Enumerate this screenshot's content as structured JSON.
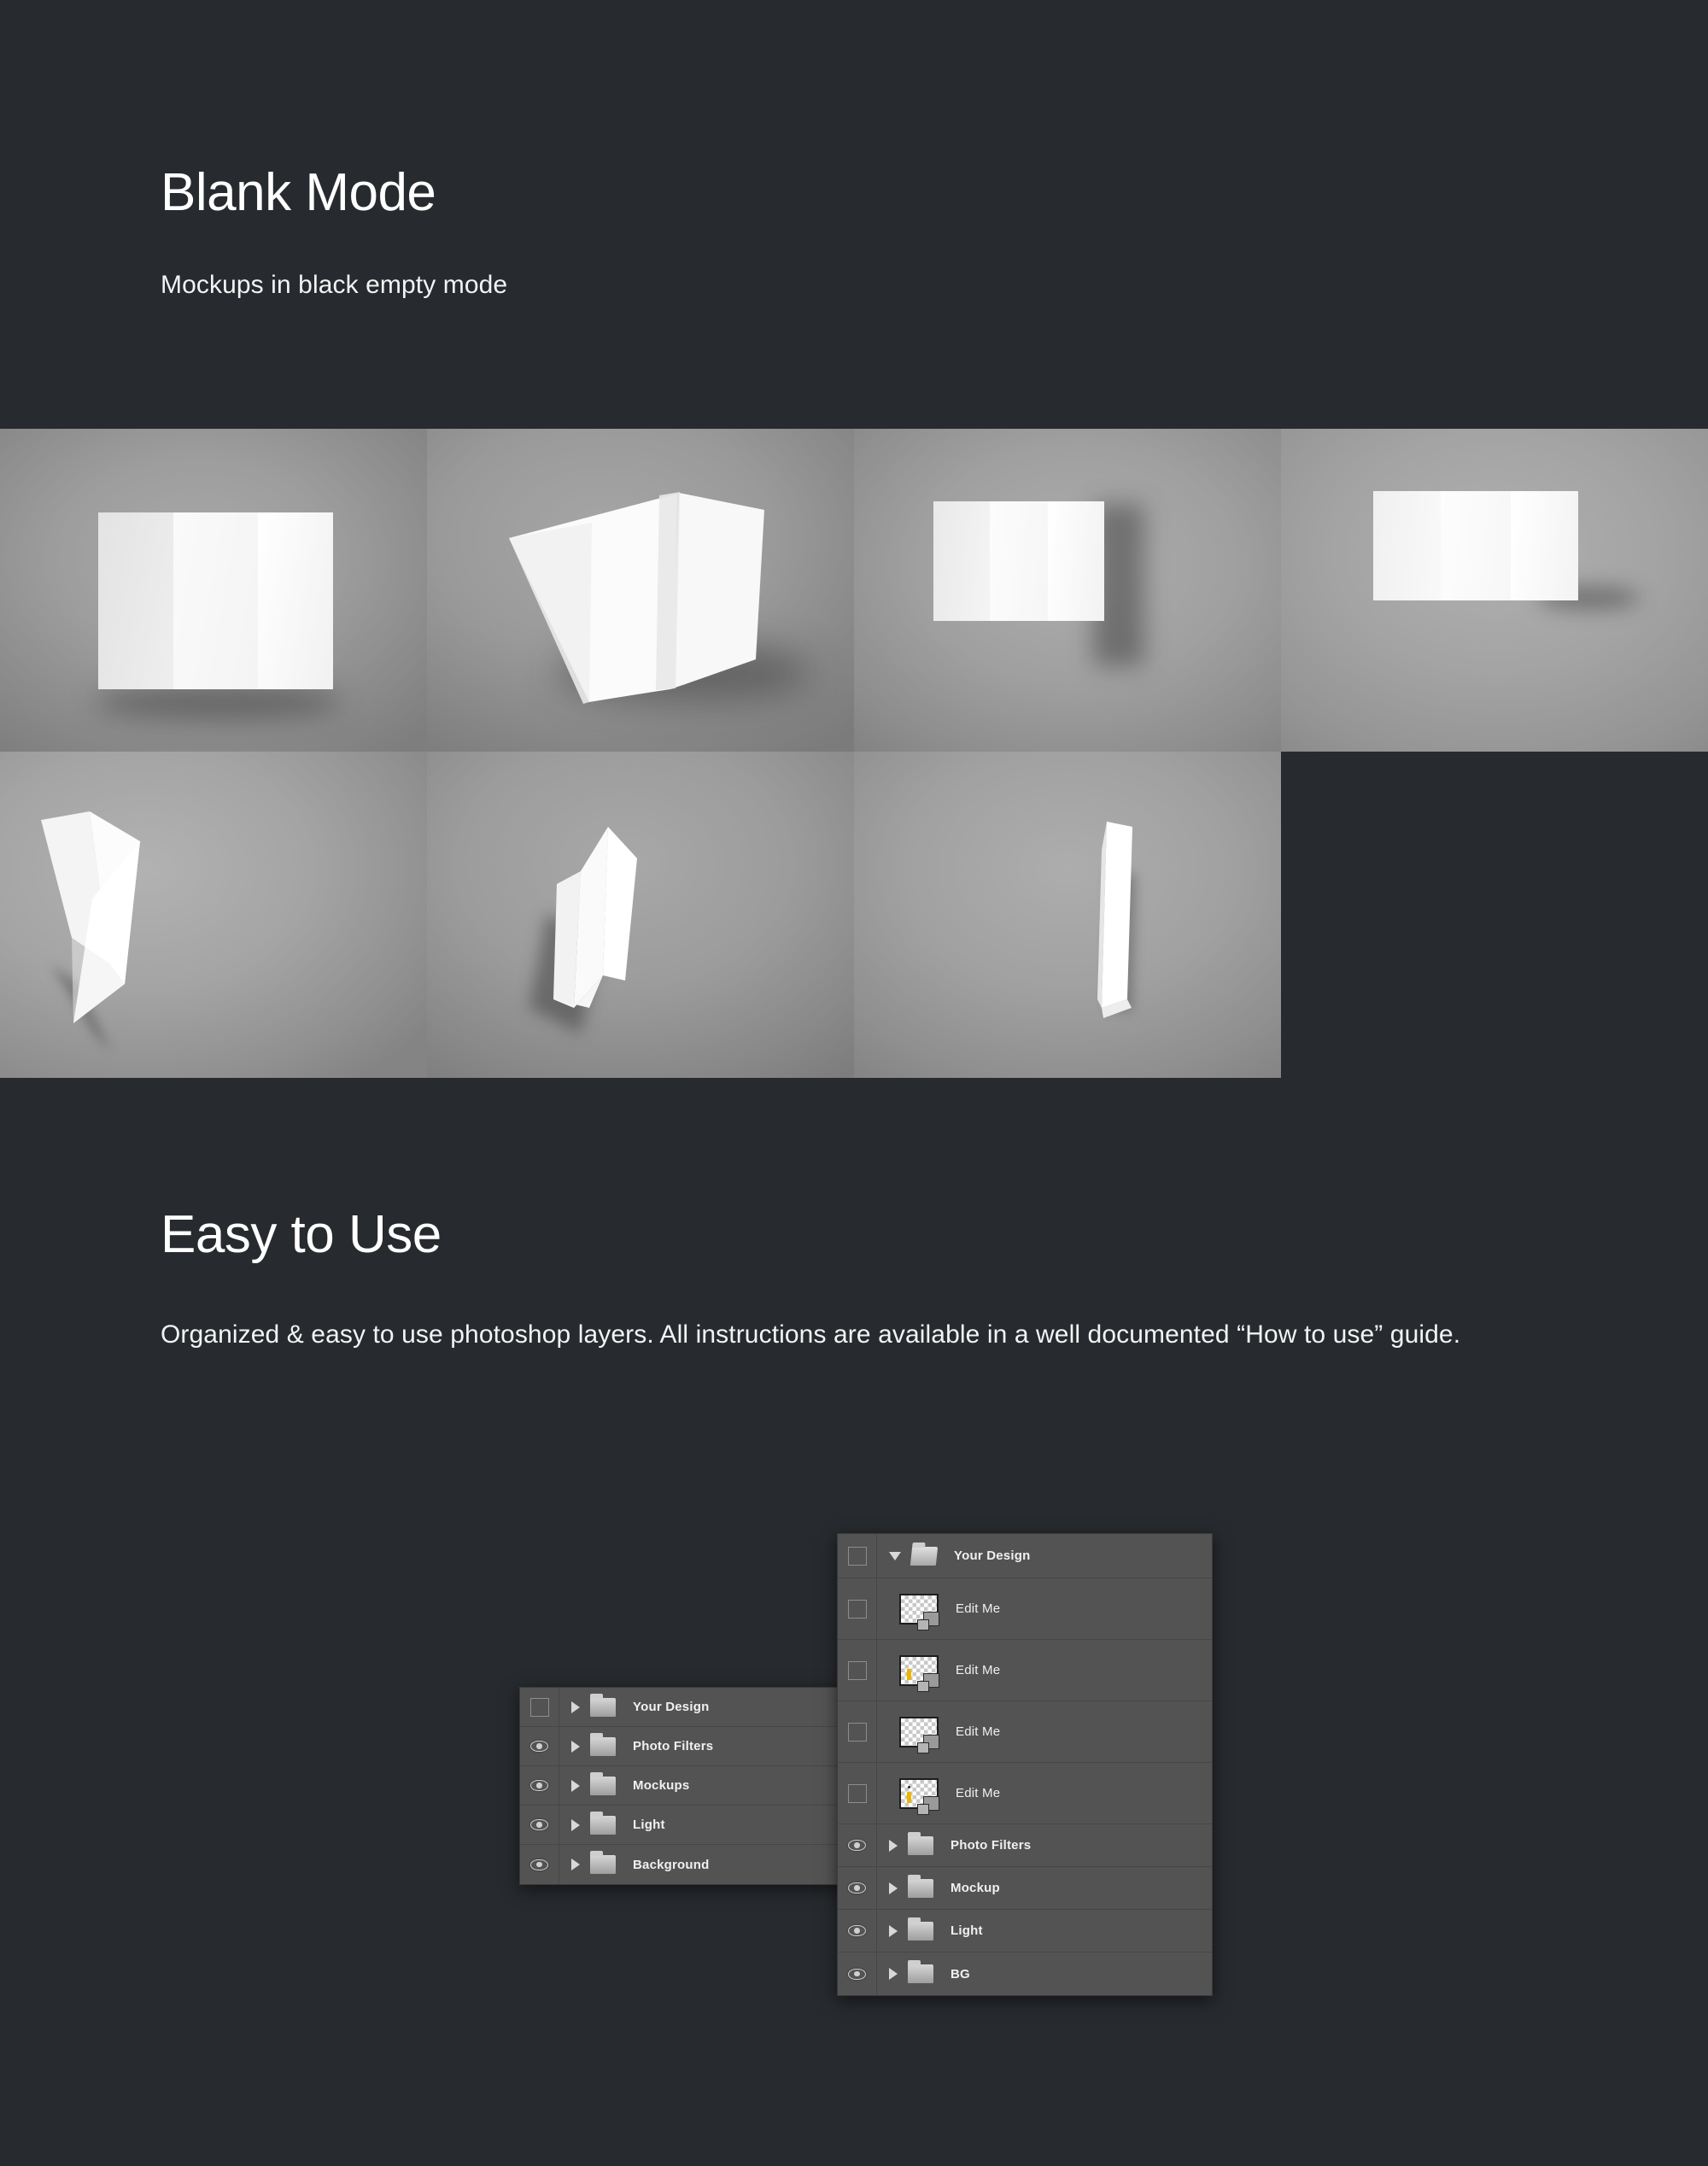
{
  "sections": [
    {
      "id": "blank-mode",
      "title": "Blank Mode",
      "subtitle": "Mockups in black empty mode"
    },
    {
      "id": "easy-to-use",
      "title": "Easy to Use",
      "body": "Organized & easy to use photoshop layers. All instructions are available in a well documented “How to use” guide."
    }
  ],
  "mockups": {
    "row1": [
      {
        "name": "trifold-front-flat-open"
      },
      {
        "name": "trifold-angled-open-perspective"
      },
      {
        "name": "trifold-inside-spread-standing"
      },
      {
        "name": "trifold-inside-spread-front"
      }
    ],
    "row2": [
      {
        "name": "trifold-tilted-open-top-view"
      },
      {
        "name": "trifold-tilted-open-angled"
      },
      {
        "name": "trifold-closed-tilted"
      }
    ]
  },
  "layers_panel_front": {
    "rows": [
      {
        "name": "Your Design",
        "type": "group",
        "visible": false,
        "expanded": true,
        "indent": 0
      },
      {
        "name": "Edit Me",
        "type": "layer",
        "visible": false,
        "indent": 1,
        "thumb": "transparent-smart-object"
      },
      {
        "name": "Edit Me",
        "type": "layer",
        "visible": false,
        "indent": 1,
        "thumb": "transparent-smart-object"
      },
      {
        "name": "Edit Me",
        "type": "layer",
        "visible": false,
        "indent": 1,
        "thumb": "transparent-smart-object"
      },
      {
        "name": "Edit Me",
        "type": "layer",
        "visible": false,
        "indent": 1,
        "thumb": "transparent-smart-object"
      },
      {
        "name": "Photo Filters",
        "type": "group",
        "visible": true,
        "expanded": false,
        "indent": 0
      },
      {
        "name": "Mockup",
        "type": "group",
        "visible": true,
        "expanded": false,
        "indent": 0
      },
      {
        "name": "Light",
        "type": "group",
        "visible": true,
        "expanded": false,
        "indent": 0
      },
      {
        "name": "BG",
        "type": "group",
        "visible": true,
        "expanded": false,
        "indent": 0
      }
    ]
  },
  "layers_panel_back": {
    "rows": [
      {
        "name": "Your Design",
        "type": "group",
        "visible": false,
        "expanded": false
      },
      {
        "name": "Photo Filters",
        "type": "group",
        "visible": true,
        "expanded": false
      },
      {
        "name": "Mockups",
        "type": "group",
        "visible": true,
        "expanded": false
      },
      {
        "name": "Light",
        "type": "group",
        "visible": true,
        "expanded": false
      },
      {
        "name": "Background",
        "type": "group",
        "visible": true,
        "expanded": false
      }
    ]
  },
  "colors": {
    "page_background": "#272a2e",
    "heading_text": "#ffffff",
    "body_text": "#f2f3f4",
    "panel_bg": "#535353",
    "panel_border": "#3a3a3a",
    "row_divider": "#464646",
    "icon_light": "#d8d8d8",
    "smart_object_accent": "#f0b400"
  },
  "icons": {
    "eye": "eye-icon",
    "triangle_right": "chevron-right-icon",
    "triangle_down": "chevron-down-icon",
    "folder": "folder-icon",
    "folder_open": "folder-open-icon",
    "checkbox": "checkbox-icon",
    "thumbnail": "layer-thumbnail-icon"
  }
}
